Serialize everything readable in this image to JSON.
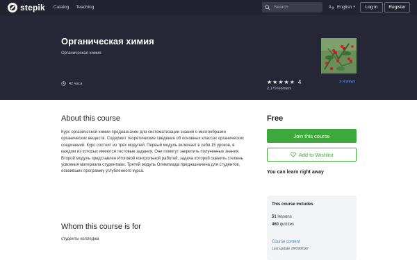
{
  "nav": {
    "logo_text": "stepik",
    "links": [
      "Catalog",
      "Teaching"
    ],
    "search_placeholder": "Search",
    "language": "English",
    "login": "Log in",
    "register": "Register"
  },
  "hero": {
    "title": "Органическая химия",
    "subtitle": "Органическая химия",
    "hours": "42 часа",
    "rating": "4",
    "stars_filled": 4,
    "stars_total": 5,
    "learners": "2,179 learners",
    "reviews": "2 reviews"
  },
  "about": {
    "heading": "About this course",
    "text": "Курс органической химии предназначен для систематизации знаний о многообразии органических веществ. Содержит теоретические сведения об основных классах органических соединений. Курс состоит из трёх модулей. Первый модуль включает в себя 15 уроков, в каждом из которых имеются тестовые задания. Они помогут закрепить полученные знания. Второй модуль представлен Итоговой контрольной работой, задача которой оценить степень усвоения материала студентами. Третий модуль Олимпиада предназначена для студентов, освоивших программу углубленного курса."
  },
  "whom": {
    "heading": "Whom this course is for",
    "text": "студенты колледжа"
  },
  "sidebar": {
    "price": "Free",
    "join": "Join this course",
    "wishlist": "Add to Wishlist",
    "learn_right": "You can learn right away",
    "includes_title": "This course includes",
    "lessons_count": "51",
    "lessons_label": "lessons",
    "quizzes_count": "460",
    "quizzes_label": "quizzes",
    "content_link": "Course content",
    "last_update": "Last update 18/09/2022"
  },
  "colors": {
    "nav_bg": "#222330",
    "hero_bg": "#252636",
    "accent_green": "#3fa83d",
    "link_blue": "#3a7bd5"
  }
}
